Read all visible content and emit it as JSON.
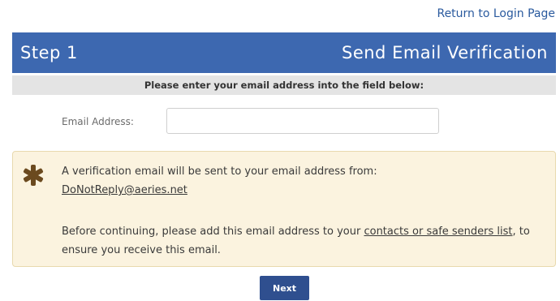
{
  "header": {
    "return_link": "Return to Login Page"
  },
  "step": {
    "number": "Step 1",
    "title": "Send Email Verification"
  },
  "instruction": "Please enter your email address into the field below:",
  "form": {
    "email_label": "Email Address:",
    "email_value": "",
    "email_placeholder": ""
  },
  "notice": {
    "icon": "asterisk-icon",
    "line1": "A verification email will be sent to your email address from:",
    "sender_email": "DoNotReply@aeries.net",
    "para_before": "Before continuing, please add this email address to your ",
    "para_link": "contacts or safe senders list",
    "para_after": ", to ensure you receive this email."
  },
  "actions": {
    "next_label": "Next"
  },
  "colors": {
    "header_blue": "#3d68b0",
    "button_blue": "#2f4f8f",
    "notice_bg": "#fbf3df",
    "asterisk": "#6b4a1f"
  }
}
